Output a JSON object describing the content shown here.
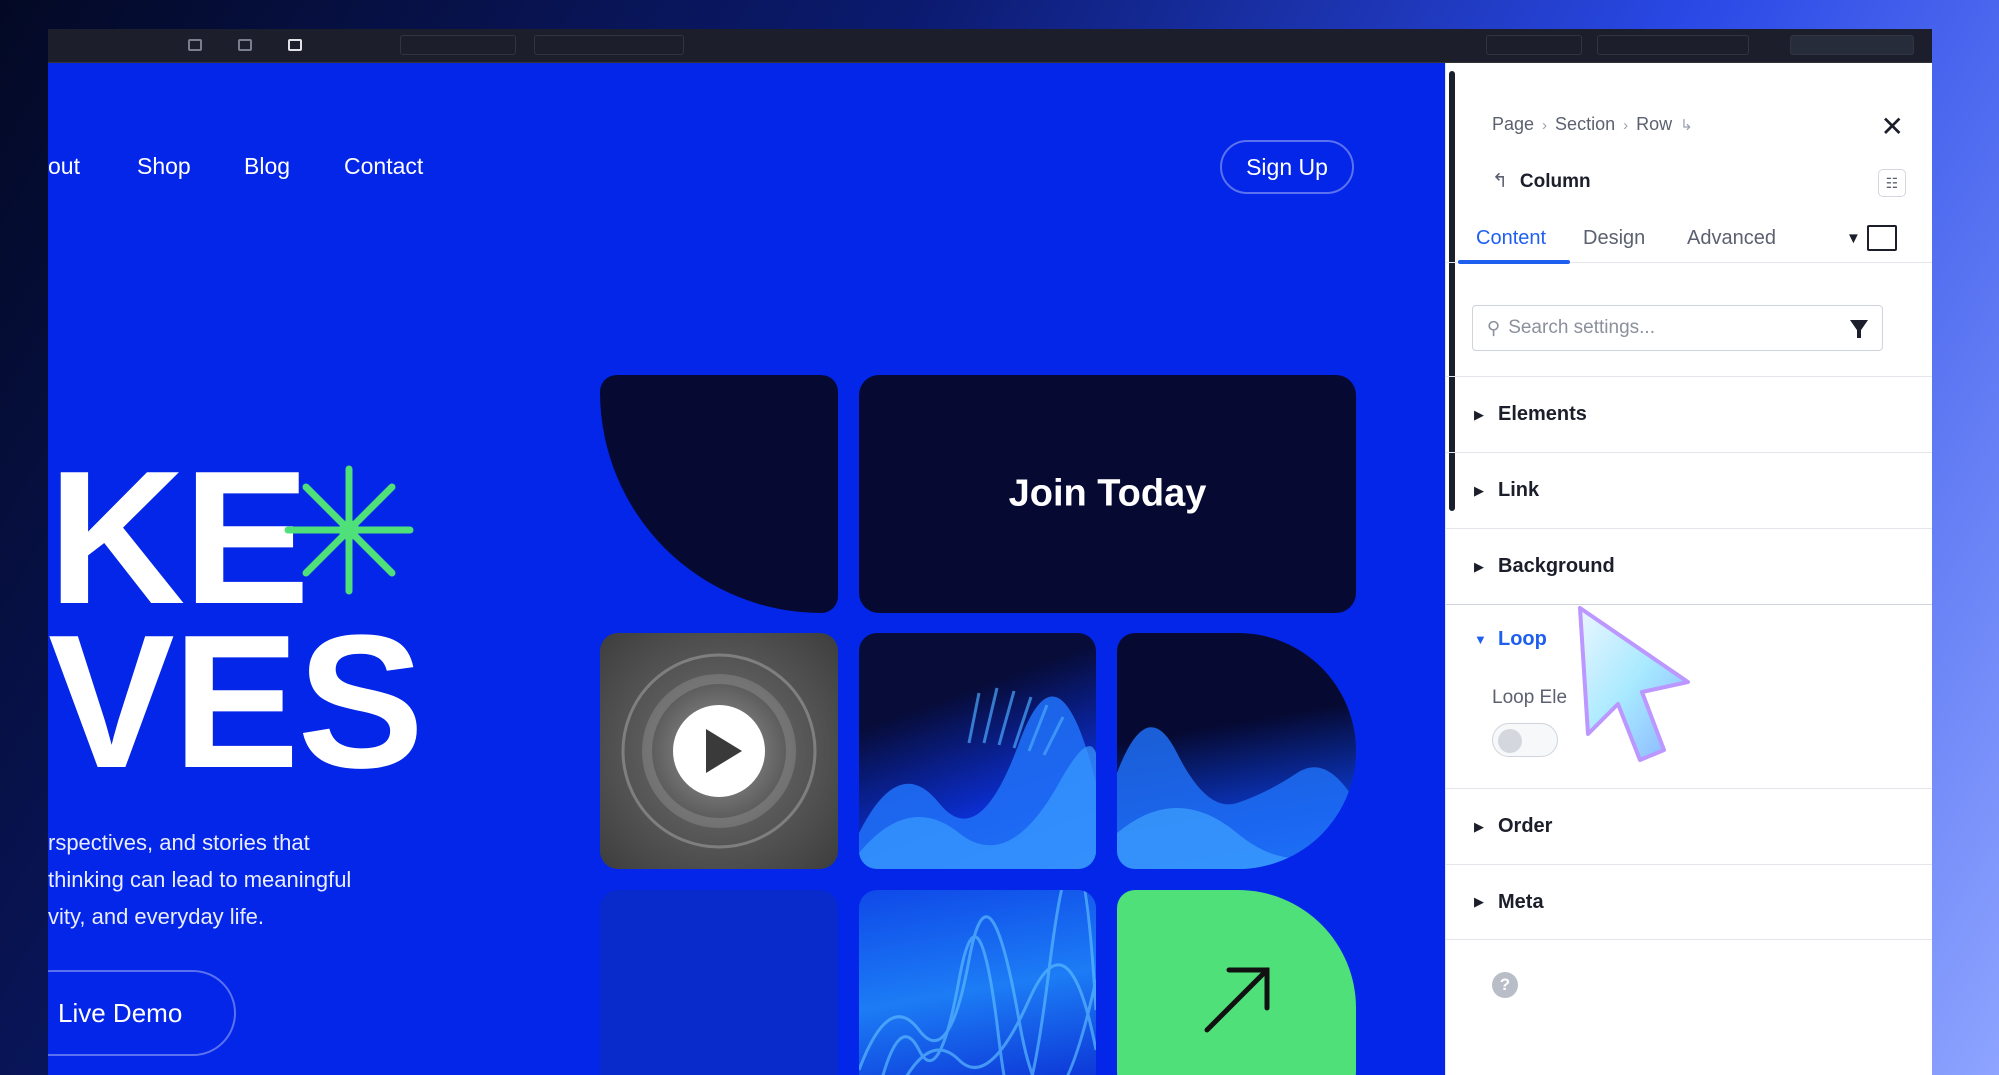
{
  "nav": {
    "links": [
      "out",
      "Shop",
      "Blog",
      "Contact"
    ],
    "signup_label": "Sign Up"
  },
  "hero": {
    "line1": "KE",
    "line2": "VES",
    "paragraph": [
      "rspectives, and stories that",
      " thinking can lead to meaningful",
      "vity, and everyday life."
    ],
    "demo_label": "Live Demo",
    "accent_color": "#4fe07a",
    "bg_color": "#0326e8"
  },
  "grid": {
    "join_label": "Join Today",
    "arrow_icon": "arrow-up-right-icon",
    "play_icon": "play-icon"
  },
  "panel": {
    "breadcrumb": [
      "Page",
      "Section",
      "Row"
    ],
    "element_title": "Column",
    "tabs": [
      "Content",
      "Design",
      "Advanced"
    ],
    "active_tab": "Content",
    "search_placeholder": "Search settings...",
    "sections": {
      "elements": "Elements",
      "link": "Link",
      "background": "Background",
      "loop": "Loop",
      "order": "Order",
      "meta": "Meta"
    },
    "loop_field_label": "Loop Ele",
    "loop_enabled": false,
    "help_label": "?",
    "accent_color": "#1f5ff0"
  }
}
